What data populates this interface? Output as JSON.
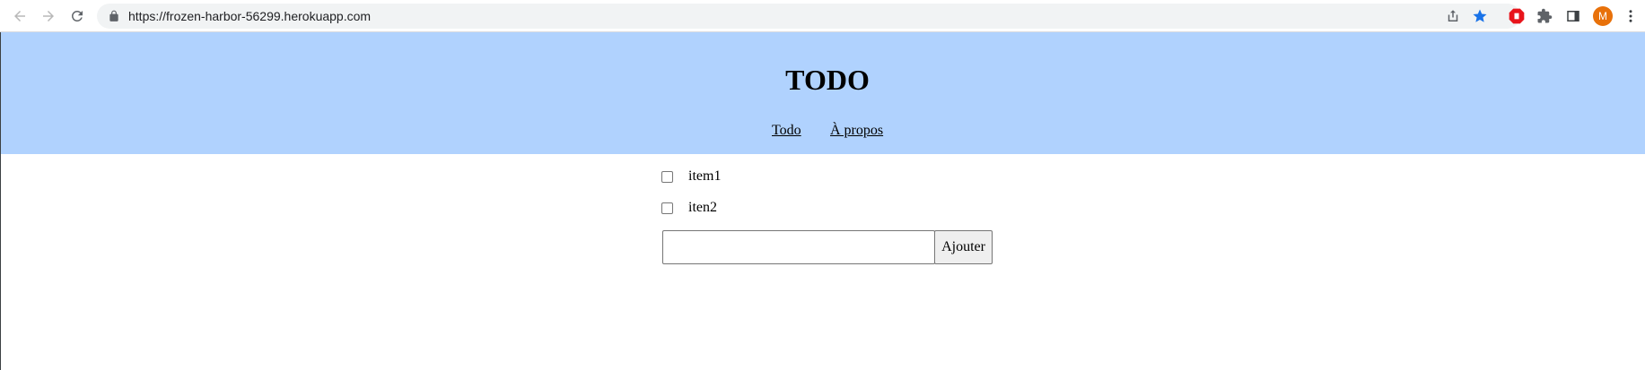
{
  "browser": {
    "url": "https://frozen-harbor-56299.herokuapp.com",
    "profile_initial": "M",
    "icons": [
      "back-icon",
      "forward-icon",
      "reload-icon",
      "lock-icon",
      "share-icon",
      "bookmark-star-icon",
      "adblock-icon",
      "extensions-icon",
      "side-panel-icon",
      "kebab-menu-icon"
    ],
    "colors": {
      "bookmark_star": "#1a73e8",
      "adblock": "#e8141b",
      "profile_avatar": "#e8710a"
    }
  },
  "header": {
    "title": "TODO",
    "background": "#b0d2fe",
    "menu": [
      {
        "label": "Todo"
      },
      {
        "label": "À propos"
      }
    ]
  },
  "todos": [
    {
      "label": "item1",
      "checked": false
    },
    {
      "label": "iten2",
      "checked": false
    }
  ],
  "form": {
    "input_value": "",
    "button_label": "Ajouter"
  }
}
